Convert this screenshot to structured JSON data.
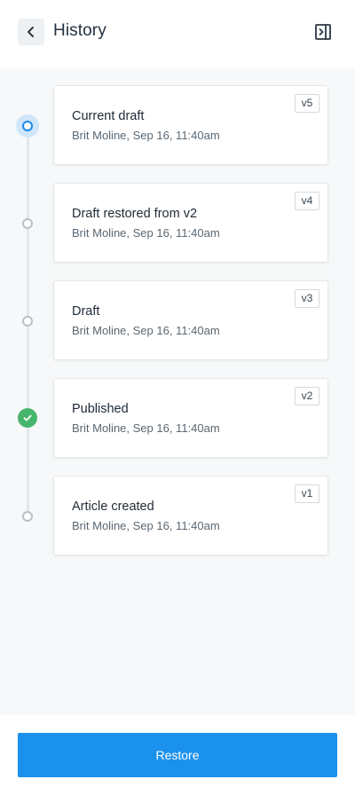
{
  "header": {
    "title": "History",
    "back_icon": "chevron-left-icon",
    "panel_icon": "collapse-panel-icon"
  },
  "colors": {
    "accent": "#1b91ee",
    "current_node": "#1c8ae6",
    "published": "#48b56f",
    "timeline": "#e3e7eb"
  },
  "versions": [
    {
      "label": "Current draft",
      "meta": "Brit Moline, Sep 16, 11:40am",
      "badge": "v5",
      "status": "current"
    },
    {
      "label": "Draft restored from v2",
      "meta": "Brit Moline, Sep 16, 11:40am",
      "badge": "v4",
      "status": "draft"
    },
    {
      "label": "Draft",
      "meta": "Brit Moline, Sep 16, 11:40am",
      "badge": "v3",
      "status": "draft"
    },
    {
      "label": "Published",
      "meta": "Brit Moline, Sep 16, 11:40am",
      "badge": "v2",
      "status": "published"
    },
    {
      "label": "Article created",
      "meta": "Brit Moline, Sep 16, 11:40am",
      "badge": "v1",
      "status": "draft"
    }
  ],
  "footer": {
    "restore_label": "Restore"
  }
}
